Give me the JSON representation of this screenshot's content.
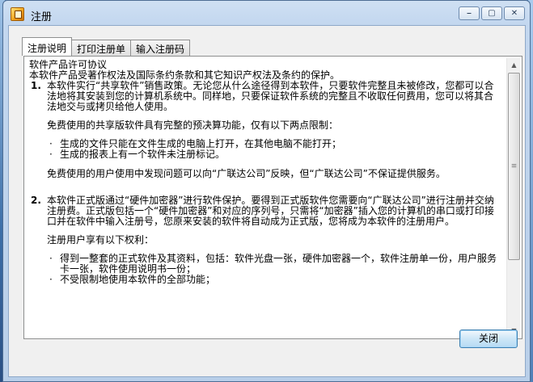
{
  "window": {
    "title": "注册",
    "minimize": "⎯",
    "maximize": "▢",
    "close": "✕"
  },
  "tabs": [
    {
      "label": "注册说明",
      "active": true
    },
    {
      "label": "打印注册单",
      "active": false
    },
    {
      "label": "输入注册码",
      "active": false
    }
  ],
  "document": {
    "title": "软件产品许可协议",
    "intro": "本软件产品受著作权法及国际条约条款和其它知识产权法及条约的保护。",
    "section1": {
      "number": "1.",
      "para1": "本软件实行“共享软件”销售政策。无论您从什么途径得到本软件，只要软件完整且未被修改，您都可以合法地将其安装到您的计算机系统中。同样地，只要保证软件系统的完整且不收取任何费用，您可以将其合法地交与或拷贝给他人使用。",
      "para2": "免费使用的共享版软件具有完整的预决算功能，仅有以下两点限制：",
      "bullet1": "生成的文件只能在文件生成的电脑上打开，在其他电脑不能打开；",
      "bullet2": "生成的报表上有一个软件未注册标记。",
      "para3": "免费使用的用户使用中发现问题可以向“广联达公司”反映，但“广联达公司”不保证提供服务。"
    },
    "section2": {
      "number": "2.",
      "para1": "本软件正式版通过“硬件加密器”进行软件保护。要得到正式版软件您需要向“广联达公司”进行注册并交纳注册费。正式版包括一个“硬件加密器”和对应的序列号，只需将“加密器”插入您的计算机的串口或打印接口并在软件中输入注册号，您原来安装的软件将自动成为正式版，您将成为本软件的注册用户。",
      "para2": "注册用户享有以下权利：",
      "bullet1": "得到一整套的正式软件及其资料，包括：软件光盘一张，硬件加密器一个，软件注册单一份，用户服务卡一张，软件使用说明书一份；",
      "bullet2": "不受限制地使用本软件的全部功能；"
    }
  },
  "scrollbar": {
    "up": "▲",
    "down": "▼",
    "grip": "≡",
    "position": 0.0
  },
  "buttons": {
    "close": "关闭"
  }
}
